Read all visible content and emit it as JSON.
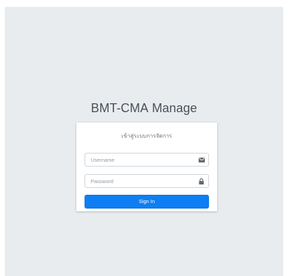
{
  "logo": {
    "brand": "BMT-CMA",
    "suffix": "Manage"
  },
  "login": {
    "message": "เข้าสู่ระบบการจัดการ",
    "username": {
      "placeholder": "Username",
      "value": "",
      "icon": "envelope-icon"
    },
    "password": {
      "placeholder": "Password",
      "value": "",
      "icon": "lock-icon"
    },
    "submit_label": "Sign In"
  },
  "colors": {
    "background": "#e9ecef",
    "primary": "#0d7ef3",
    "icon": "#5f6a74"
  }
}
